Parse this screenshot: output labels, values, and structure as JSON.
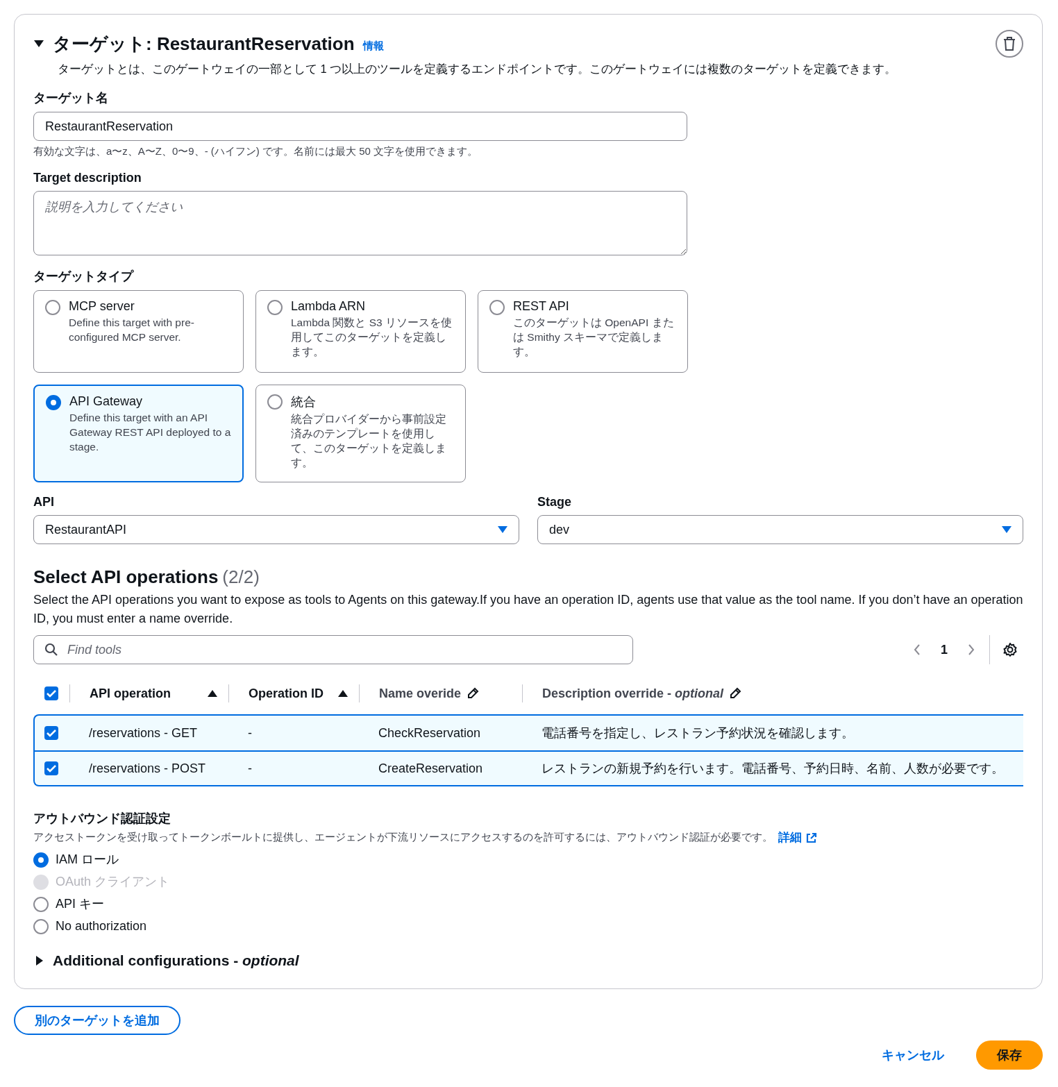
{
  "target": {
    "expanded": true,
    "title": "ターゲット: RestaurantReservation",
    "info_link": "情報",
    "description": "ターゲットとは、このゲートウェイの一部として 1 つ以上のツールを定義するエンドポイントです。このゲートウェイには複数のターゲットを定義できます。"
  },
  "name_field": {
    "label": "ターゲット名",
    "value": "RestaurantReservation",
    "hint": "有効な文字は、a〜z、A〜Z、0〜9、- (ハイフン) です。名前には最大 50 文字を使用できます。"
  },
  "description_field": {
    "label": "Target description",
    "placeholder": "説明を入力してください"
  },
  "target_type": {
    "label": "ターゲットタイプ",
    "options": [
      {
        "label": "MCP server",
        "description": "Define this target with pre-configured MCP server.",
        "selected": false
      },
      {
        "label": "Lambda ARN",
        "description": "Lambda 関数と S3 リソースを使用してこのターゲットを定義します。",
        "selected": false
      },
      {
        "label": "REST API",
        "description": "このターゲットは OpenAPI または Smithy スキーマで定義します。",
        "selected": false
      },
      {
        "label": "API Gateway",
        "description": "Define this target with an API Gateway REST API deployed to a stage.",
        "selected": true
      },
      {
        "label": "統合",
        "description": "統合プロバイダーから事前設定済みのテンプレートを使用して、このターゲットを定義します。",
        "selected": false
      }
    ]
  },
  "api_select": {
    "label": "API",
    "value": "RestaurantAPI"
  },
  "stage_select": {
    "label": "Stage",
    "value": "dev"
  },
  "operations": {
    "title": "Select API operations",
    "count": "(2/2)",
    "description": "Select the API operations you want to expose as tools to Agents on this gateway.If you have an operation ID, agents use that value as the tool name. If you don’t have an operation ID, you must enter a name override.",
    "search_placeholder": "Find tools",
    "page": "1",
    "all_checked": true,
    "columns": [
      {
        "label": "API operation",
        "kind": "sort"
      },
      {
        "label": "Operation ID",
        "kind": "sort"
      },
      {
        "label": "Name overide",
        "kind": "edit"
      },
      {
        "label": "Description override - *optional*",
        "kind": "edit"
      }
    ],
    "rows": [
      {
        "checked": true,
        "operation": "/reservations - GET",
        "operation_id": "-",
        "name": "CheckReservation",
        "description": "電話番号を指定し、レストラン予約状況を確認します。"
      },
      {
        "checked": true,
        "operation": "/reservations - POST",
        "operation_id": "-",
        "name": "CreateReservation",
        "description": "レストランの新規予約を行います。電話番号、予約日時、名前、人数が必要です。"
      }
    ]
  },
  "outbound": {
    "label": "アウトバウンド認証設定",
    "description": "アクセストークンを受け取ってトークンボールトに提供し、エージェントが下流リソースにアクセスするのを許可するには、アウトバウンド認証が必要です。",
    "link": "詳細",
    "options": [
      {
        "label": "IAM ロール",
        "selected": true,
        "disabled": false
      },
      {
        "label": "OAuth クライアント",
        "selected": false,
        "disabled": true
      },
      {
        "label": "API キー",
        "selected": false,
        "disabled": false
      },
      {
        "label": "No authorization",
        "selected": false,
        "disabled": false
      }
    ]
  },
  "additional": {
    "label": "Additional configurations - *optional*",
    "expanded": false
  },
  "buttons": {
    "add_target": "別のターゲットを追加",
    "cancel": "キャンセル",
    "save": "保存"
  }
}
